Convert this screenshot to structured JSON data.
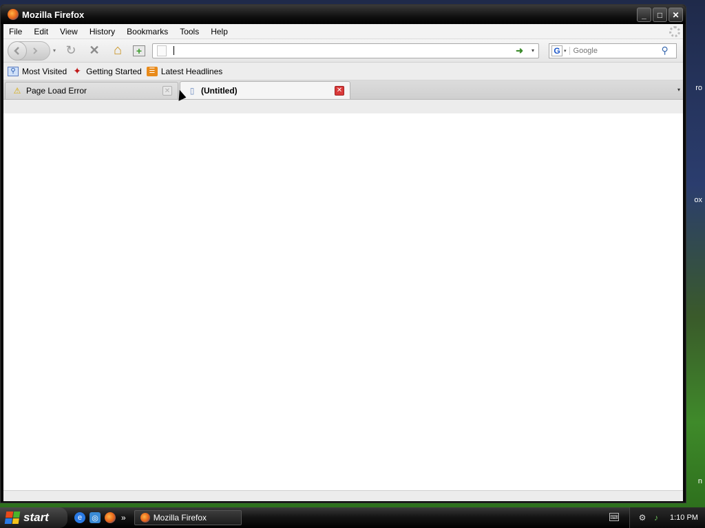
{
  "window": {
    "title": "Mozilla Firefox",
    "controls": {
      "minimize": "_",
      "maximize": "□",
      "close": "✕"
    }
  },
  "menubar": {
    "items": [
      "File",
      "Edit",
      "View",
      "History",
      "Bookmarks",
      "Tools",
      "Help"
    ]
  },
  "navbar": {
    "back_icon": "back-arrow-icon",
    "forward_icon": "forward-arrow-icon",
    "reload_icon": "↻",
    "stop_icon": "✕",
    "home_icon": "⌂",
    "bookmark_add_icon": "+",
    "url_value": "",
    "url_go": "➜",
    "dropdown": "▾",
    "search_engine": "G",
    "search_placeholder": "Google",
    "search_go": "⚲"
  },
  "bookmarks": {
    "items": [
      {
        "label": "Most Visited",
        "icon": "⚲"
      },
      {
        "label": "Getting Started",
        "icon": "✦"
      },
      {
        "label": "Latest Headlines",
        "icon": "☰"
      }
    ]
  },
  "tabs": [
    {
      "label": "Page Load Error",
      "icon": "⚠",
      "active": false
    },
    {
      "label": "(Untitled)",
      "icon": "▯",
      "active": true
    }
  ],
  "tab_close": "✕",
  "tab_list": "▾",
  "taskbar": {
    "start_label": "start",
    "quicklaunch_more": "»",
    "task_label": "Mozilla Firefox",
    "clock": "1:10 PM"
  },
  "desktop": {
    "text_1": "ro",
    "text_2": "ox",
    "text_3": "n"
  },
  "colors": {
    "tab_close_active": "#d93a3a",
    "url_go": "#3a8a2a"
  }
}
